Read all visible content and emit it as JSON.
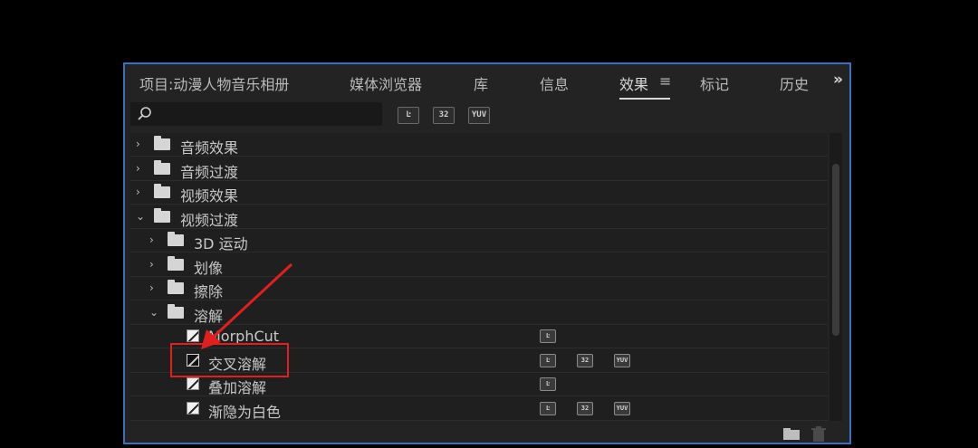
{
  "panel": {
    "tabs": [
      {
        "label": "项目:动漫人物音乐相册"
      },
      {
        "label": "媒体浏览器"
      },
      {
        "label": "库"
      },
      {
        "label": "信息"
      },
      {
        "label": "效果"
      },
      {
        "label": "标记"
      },
      {
        "label": "历史"
      }
    ],
    "active_tab": "效果",
    "menu_icon": "≡",
    "more_icon": "»"
  },
  "search": {
    "placeholder": ""
  },
  "filter_buttons": [
    {
      "name": "accelerated-effects",
      "text": "Ŀ"
    },
    {
      "name": "32-bit-color",
      "text": "32"
    },
    {
      "name": "yuv-effects",
      "text": "YUV"
    }
  ],
  "tree": [
    {
      "label": "音频效果",
      "expanded": false,
      "level": 0,
      "type": "folder"
    },
    {
      "label": "音频过渡",
      "expanded": false,
      "level": 0,
      "type": "folder"
    },
    {
      "label": "视频效果",
      "expanded": false,
      "level": 0,
      "type": "folder"
    },
    {
      "label": "视频过渡",
      "expanded": true,
      "level": 0,
      "type": "folder"
    },
    {
      "label": "3D 运动",
      "expanded": false,
      "level": 1,
      "type": "folder"
    },
    {
      "label": "划像",
      "expanded": false,
      "level": 1,
      "type": "folder"
    },
    {
      "label": "擦除",
      "expanded": false,
      "level": 1,
      "type": "folder"
    },
    {
      "label": "溶解",
      "expanded": true,
      "level": 1,
      "type": "folder"
    },
    {
      "label": "MorphCut",
      "level": 2,
      "type": "effect",
      "badges": [
        "accelerated"
      ]
    },
    {
      "label": "交叉溶解",
      "level": 2,
      "type": "effect",
      "selected": true,
      "badges": [
        "accelerated",
        "32",
        "yuv"
      ]
    },
    {
      "label": "叠加溶解",
      "level": 2,
      "type": "effect",
      "badges": [
        "accelerated"
      ]
    },
    {
      "label": "渐隐为白色",
      "level": 2,
      "type": "effect",
      "badges": [
        "accelerated",
        "32",
        "yuv"
      ]
    }
  ],
  "badge_text": {
    "accelerated": "Ŀ",
    "32": "32",
    "yuv": "YUV"
  },
  "bottom": {
    "new_folder_icon": "folder-icon",
    "delete_icon": "trash-icon"
  },
  "annotation": {
    "color": "#e0201e"
  }
}
